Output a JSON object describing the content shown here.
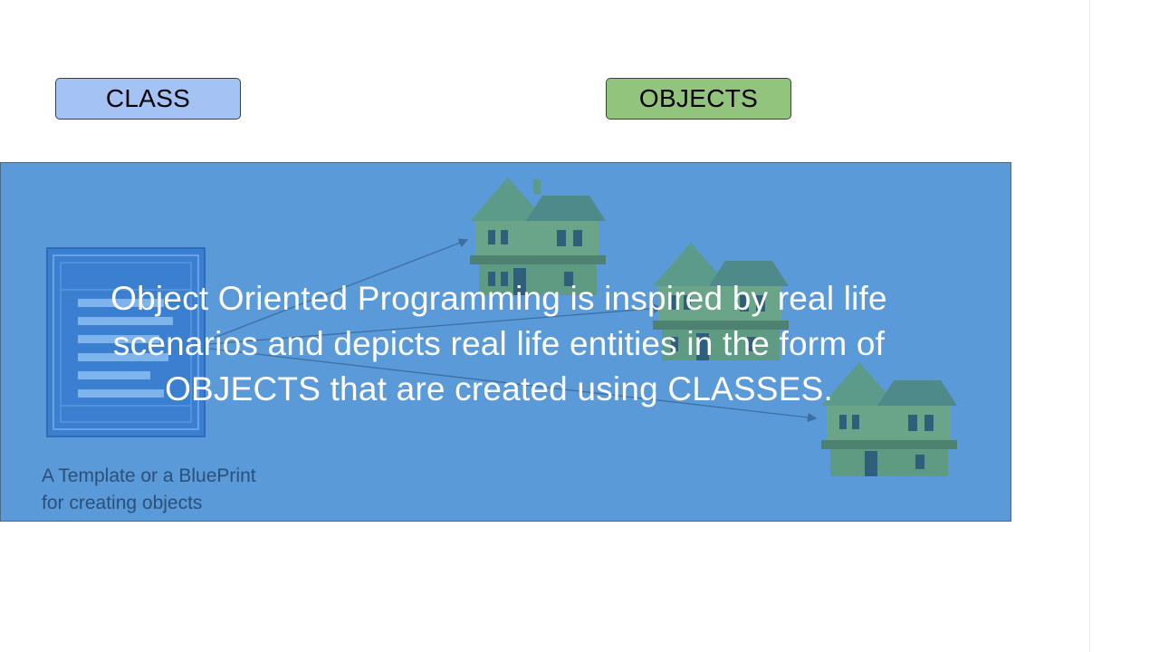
{
  "slide": {
    "class_label": "CLASS",
    "objects_label": "OBJECTS",
    "caption_lines": [
      "A Template or a BluePrint",
      "for creating objects"
    ],
    "subtitle_lines": [
      "Object Oriented Programming is inspired by real life",
      "scenarios and depicts real life entities in the form of",
      "OBJECTS that are created using CLASSES."
    ]
  },
  "icons": {
    "blueprint": "blueprint-document-icon",
    "house": "house-icon"
  },
  "colors": {
    "class_box": "#a4c2f4",
    "objects_box": "#93c47d",
    "banner": "#5b9ad9",
    "subtitle_text": "#ffffff",
    "caption_text": "#2c4f78"
  }
}
